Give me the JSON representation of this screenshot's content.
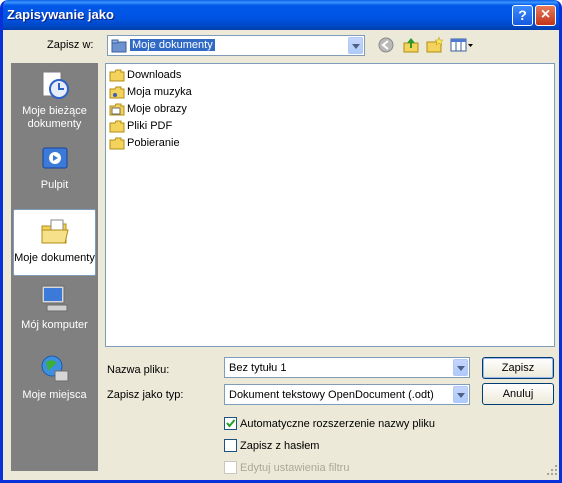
{
  "title": "Zapisywanie jako",
  "titlebar": {
    "help": "?",
    "close": "×"
  },
  "save_in": {
    "label": "Zapisz w:",
    "value": "Moje dokumenty"
  },
  "places": [
    {
      "label": "Moje bieżące dokumenty",
      "icon": "recent-documents-icon"
    },
    {
      "label": "Pulpit",
      "icon": "desktop-icon"
    },
    {
      "label": "Moje dokumenty",
      "icon": "my-documents-icon"
    },
    {
      "label": "Mój komputer",
      "icon": "my-computer-icon"
    },
    {
      "label": "Moje miejsca",
      "icon": "network-places-icon"
    }
  ],
  "files": [
    {
      "name": "Downloads",
      "icon": "folder-icon"
    },
    {
      "name": "Moja muzyka",
      "icon": "music-folder-icon"
    },
    {
      "name": "Moje obrazy",
      "icon": "pictures-folder-icon"
    },
    {
      "name": "Pliki PDF",
      "icon": "folder-icon"
    },
    {
      "name": "Pobieranie",
      "icon": "folder-icon"
    }
  ],
  "filename": {
    "label": "Nazwa pliku:",
    "value": "Bez tytułu 1"
  },
  "filetype": {
    "label": "Zapisz jako typ:",
    "value": "Dokument tekstowy OpenDocument (.odt)"
  },
  "buttons": {
    "save": "Zapisz",
    "cancel": "Anuluj"
  },
  "options": {
    "auto_ext": {
      "label": "Automatyczne rozszerzenie nazwy pliku",
      "checked": true
    },
    "password": {
      "label": "Zapisz z hasłem",
      "checked": false
    },
    "filter": {
      "label": "Edytuj ustawienia filtru",
      "checked": false,
      "disabled": true
    }
  },
  "colors": {
    "titlebar": "#0054e3",
    "dialog_bg": "#ece9d8",
    "places_bg": "#808080",
    "accent": "#316ac5"
  }
}
